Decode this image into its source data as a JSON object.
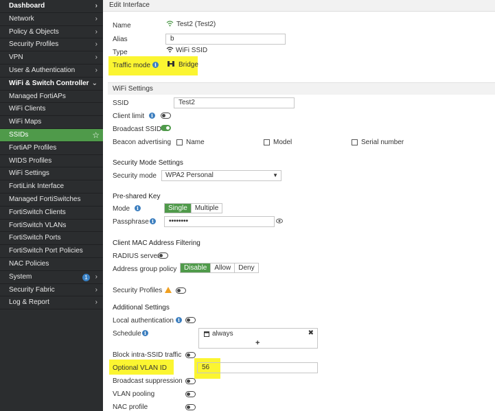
{
  "sidebar": {
    "items": [
      {
        "label": "Dashboard",
        "arrow": "›"
      },
      {
        "label": "Network",
        "arrow": "›"
      },
      {
        "label": "Policy & Objects",
        "arrow": "›"
      },
      {
        "label": "Security Profiles",
        "arrow": "›"
      },
      {
        "label": "VPN",
        "arrow": "›"
      },
      {
        "label": "User & Authentication",
        "arrow": "›"
      },
      {
        "label": "WiFi & Switch Controller",
        "arrow": "⌄"
      },
      {
        "label": "Managed FortiAPs"
      },
      {
        "label": "WiFi Clients"
      },
      {
        "label": "WiFi Maps"
      },
      {
        "label": "SSIDs",
        "star": "☆"
      },
      {
        "label": "FortiAP Profiles"
      },
      {
        "label": "WIDS Profiles"
      },
      {
        "label": "WiFi Settings"
      },
      {
        "label": "FortiLink Interface"
      },
      {
        "label": "Managed FortiSwitches"
      },
      {
        "label": "FortiSwitch Clients"
      },
      {
        "label": "FortiSwitch VLANs"
      },
      {
        "label": "FortiSwitch Ports"
      },
      {
        "label": "FortiSwitch Port Policies"
      },
      {
        "label": "NAC Policies"
      },
      {
        "label": "System",
        "arrow": "›",
        "badge": "1"
      },
      {
        "label": "Security Fabric",
        "arrow": "›"
      },
      {
        "label": "Log & Report",
        "arrow": "›"
      }
    ]
  },
  "header": {
    "title": "Edit Interface"
  },
  "interface": {
    "name_label": "Name",
    "name_value": "Test2 (Test2)",
    "alias_label": "Alias",
    "alias_value": "b",
    "type_label": "Type",
    "type_value": "WiFi SSID",
    "traffic_mode_label": "Traffic mode",
    "traffic_mode_value": "Bridge"
  },
  "wifi_settings": {
    "title": "WiFi Settings",
    "ssid_label": "SSID",
    "ssid_value": "Test2",
    "client_limit_label": "Client limit",
    "broadcast_ssid_label": "Broadcast SSID",
    "beacon_label": "Beacon advertising",
    "beacon_options": [
      "Name",
      "Model",
      "Serial number"
    ]
  },
  "security_mode": {
    "title": "Security Mode Settings",
    "label": "Security mode",
    "value": "WPA2 Personal"
  },
  "psk": {
    "title": "Pre-shared Key",
    "mode_label": "Mode",
    "mode_options": [
      "Single",
      "Multiple"
    ],
    "passphrase_label": "Passphrase",
    "passphrase_value": "••••••••"
  },
  "mac_filter": {
    "title": "Client MAC Address Filtering",
    "radius_label": "RADIUS server",
    "address_group_label": "Address group policy",
    "options": [
      "Disable",
      "Allow",
      "Deny"
    ]
  },
  "security_profiles": {
    "label": "Security Profiles"
  },
  "additional": {
    "title": "Additional Settings",
    "local_auth_label": "Local authentication",
    "schedule_label": "Schedule",
    "schedule_value": "always",
    "schedule_add": "+",
    "schedule_remove": "✖",
    "block_intra_label": "Block intra-SSID traffic",
    "vlan_label": "Optional VLAN ID",
    "vlan_value": "56",
    "broadcast_suppression_label": "Broadcast suppression",
    "vlan_pooling_label": "VLAN pooling",
    "nac_profile_label": "NAC profile"
  },
  "colors": {
    "accent": "#4f9a4a",
    "highlight": "#fbf531",
    "sidebar": "#2b2d2f",
    "info": "#3d7fbf"
  }
}
